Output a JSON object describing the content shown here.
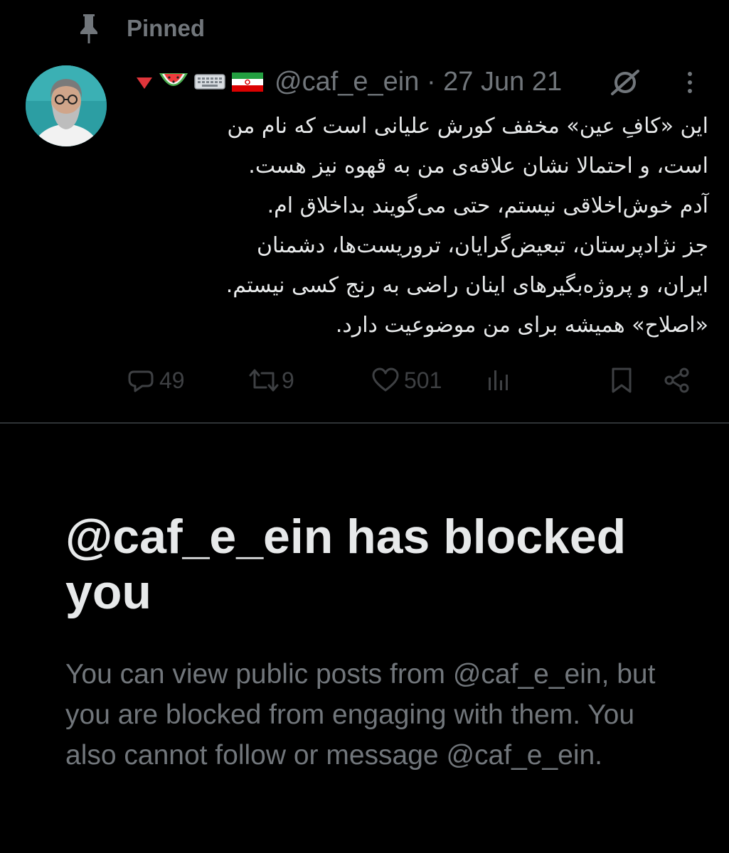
{
  "pinned": {
    "label": "Pinned",
    "icon": "pin-icon"
  },
  "tweet": {
    "author": {
      "emojis": [
        "🔻",
        "🍉",
        "⌨️",
        "🇮🇷"
      ],
      "handle": "@caf_e_ein",
      "avatar_icon": "avatar"
    },
    "separator": "·",
    "date": "27 Jun 21",
    "text": "این «کافِ عین» مخفف کورش علیانی است که نام من\nاست، و احتمالا نشان علاقه‌ی من به قهوه نیز هست.\nآدم خوش‌اخلاقی نیستم، حتی می‌گویند بداخلاق ام.\nجز نژادپرستان، تبعیض‌گرایان، تروریست‌ها، دشمنان\nایران، و پروژه‌بگیرهای اینان راضی به رنج کسی نیستم.\n«اصلاح» همیشه برای من موضوعیت دارد.",
    "stats": {
      "replies": "49",
      "reposts": "9",
      "likes": "501"
    }
  },
  "blocked": {
    "title": "@caf_e_ein has blocked you",
    "body": "You can view public posts from @caf_e_ein, but you are blocked from engaging with them. You also cannot follow or message @caf_e_ein."
  },
  "colors": {
    "background": "#000000",
    "text_primary": "#e7e9ea",
    "text_secondary": "#71767b",
    "divider": "#2f3336"
  }
}
